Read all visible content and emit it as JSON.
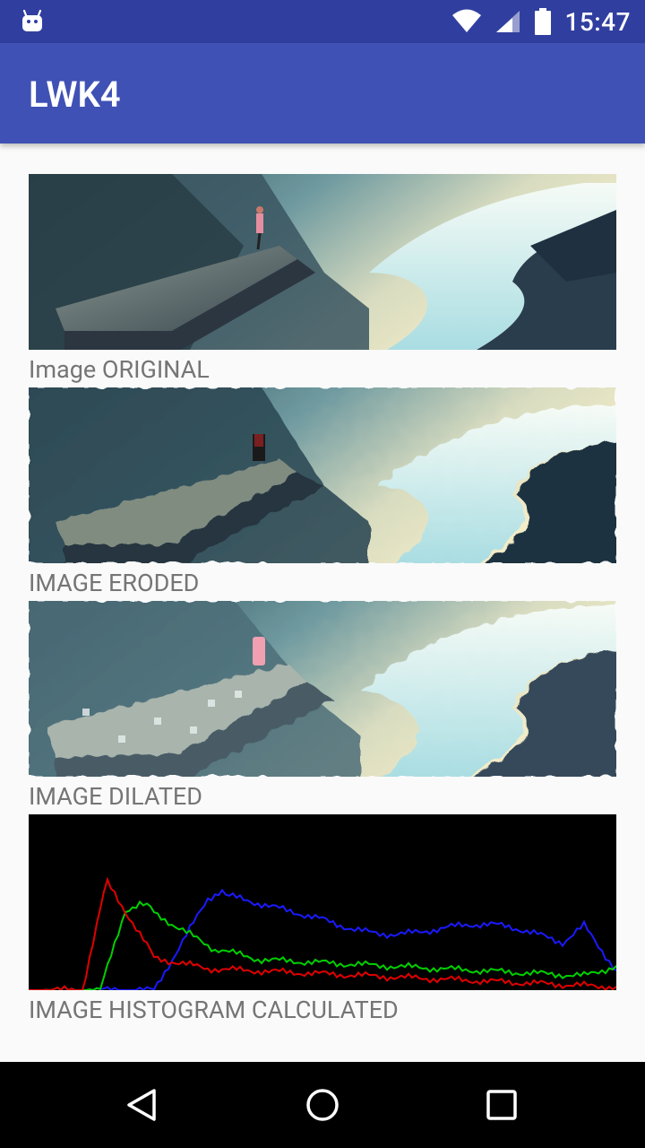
{
  "status_bar": {
    "time": "15:47",
    "icons": [
      "android-icon",
      "wifi-icon",
      "signal-icon",
      "battery-icon"
    ]
  },
  "app_bar": {
    "title": "LWK4"
  },
  "images": [
    {
      "caption": "Image ORIGINAL",
      "variant": "original"
    },
    {
      "caption": "IMAGE ERODED",
      "variant": "eroded"
    },
    {
      "caption": "IMAGE DILATED",
      "variant": "dilated"
    },
    {
      "caption": "IMAGE HISTOGRAM CALCULATED",
      "variant": "histogram"
    }
  ],
  "histogram_colors": {
    "red": "#e00000",
    "green": "#00d000",
    "blue": "#1a1aff"
  },
  "nav_bar": {
    "buttons": [
      "back-icon",
      "home-icon",
      "recents-icon"
    ]
  }
}
